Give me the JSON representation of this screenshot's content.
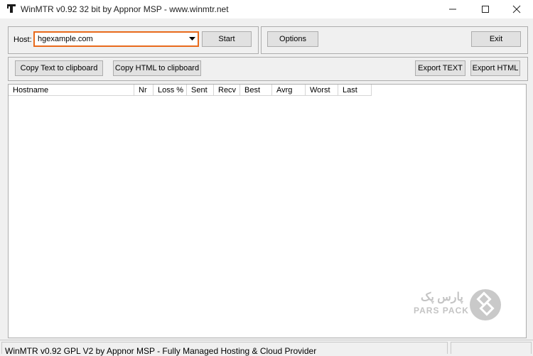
{
  "window": {
    "title": "WinMTR v0.92 32 bit by Appnor MSP - www.winmtr.net",
    "icon": "winmtr-app-icon"
  },
  "toolbar": {
    "host_label": "Host:",
    "host_value": "hgexample.com",
    "start_label": "Start",
    "options_label": "Options",
    "exit_label": "Exit",
    "copy_text_label": "Copy Text to clipboard",
    "copy_html_label": "Copy HTML to clipboard",
    "export_text_label": "Export TEXT",
    "export_html_label": "Export HTML"
  },
  "table": {
    "columns": [
      "Hostname",
      "Nr",
      "Loss %",
      "Sent",
      "Recv",
      "Best",
      "Avrg",
      "Worst",
      "Last"
    ],
    "rows": []
  },
  "watermark": {
    "fa_text": "پارس پک",
    "text": "PARS PACK"
  },
  "status": {
    "text": "WinMTR v0.92 GPL V2 by Appnor MSP - Fully Managed Hosting & Cloud Provider",
    "secondary": ""
  },
  "colors": {
    "highlight": "#e86a1c",
    "background": "#f0f0f0"
  }
}
